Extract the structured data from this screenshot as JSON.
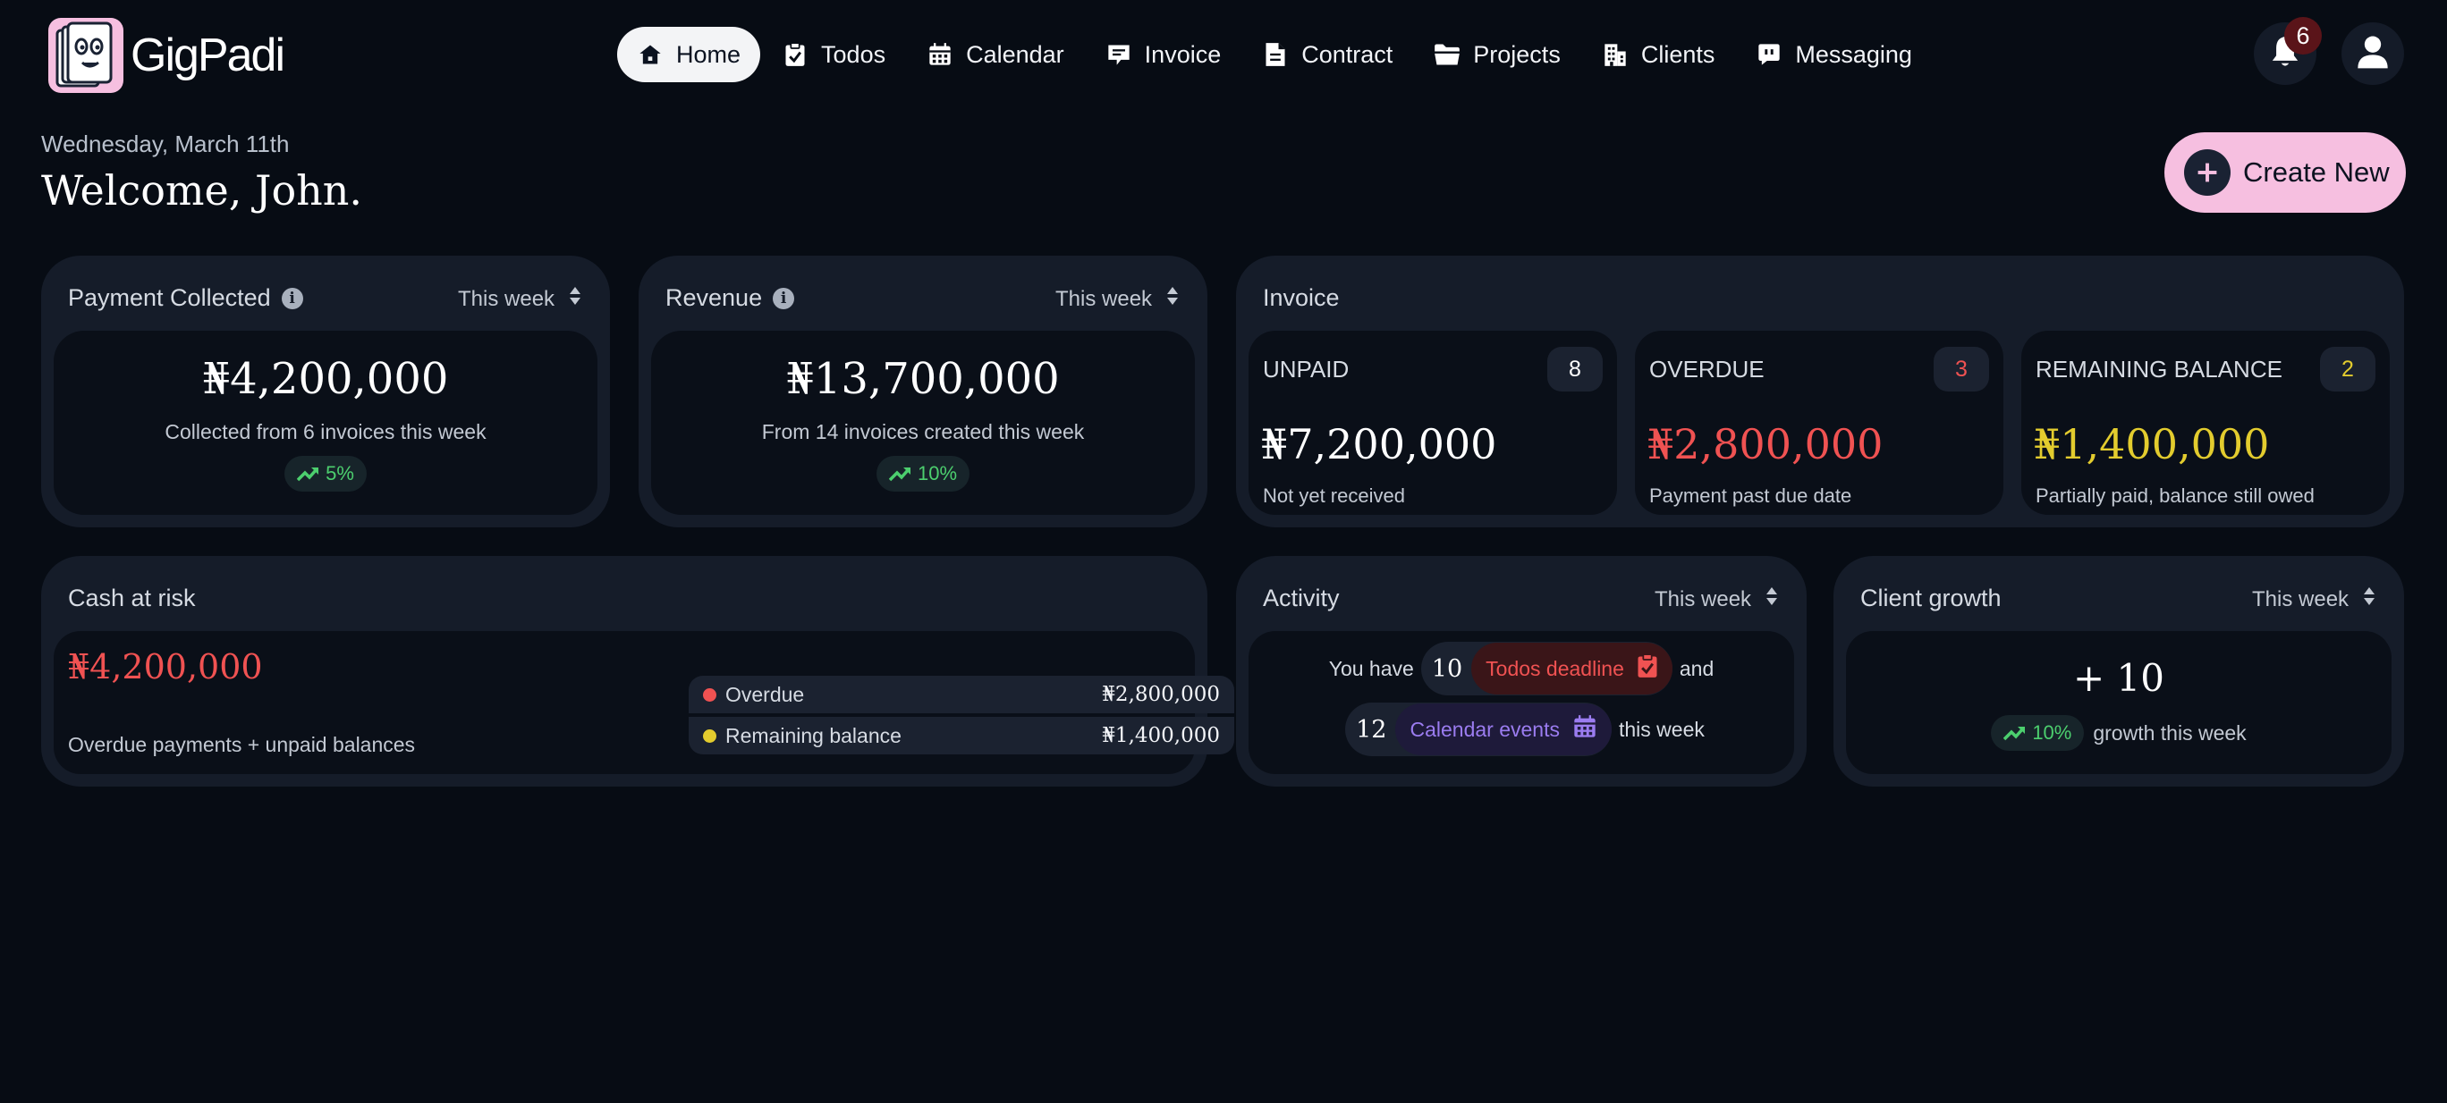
{
  "app": {
    "name": "GigPadi"
  },
  "nav": {
    "items": [
      {
        "label": "Home",
        "icon": "home-icon",
        "active": true
      },
      {
        "label": "Todos",
        "icon": "clipboard-check-icon"
      },
      {
        "label": "Calendar",
        "icon": "calendar-icon"
      },
      {
        "label": "Invoice",
        "icon": "receipt-icon"
      },
      {
        "label": "Contract",
        "icon": "document-icon"
      },
      {
        "label": "Projects",
        "icon": "folder-icon"
      },
      {
        "label": "Clients",
        "icon": "building-icon"
      },
      {
        "label": "Messaging",
        "icon": "message-icon"
      }
    ]
  },
  "notifications": {
    "count": "6"
  },
  "header": {
    "date": "Wednesday, March 11th",
    "welcome": "Welcome, John.",
    "create_label": "Create New"
  },
  "payment_collected": {
    "title": "Payment Collected",
    "period": "This week",
    "amount": "₦4,200,000",
    "caption": "Collected from 6 invoices this week",
    "change": "5%"
  },
  "revenue": {
    "title": "Revenue",
    "period": "This week",
    "amount": "₦13,700,000",
    "caption": "From 14 invoices created this week",
    "change": "10%"
  },
  "invoice": {
    "title": "Invoice",
    "boxes": [
      {
        "label": "UNPAID",
        "count": "8",
        "amount": "₦7,200,000",
        "desc": "Not yet received",
        "color": "#ffffff"
      },
      {
        "label": "OVERDUE",
        "count": "3",
        "amount": "₦2,800,000",
        "desc": "Payment past due date",
        "color": "#f05252"
      },
      {
        "label": "REMAINING BALANCE",
        "count": "2",
        "amount": "₦1,400,000",
        "desc": "Partially paid, balance still owed",
        "color": "#e3cc2e"
      }
    ]
  },
  "cash_at_risk": {
    "title": "Cash at risk",
    "amount": "₦4,200,000",
    "caption": "Overdue payments + unpaid balances",
    "rows": [
      {
        "label": "Overdue",
        "value": "₦2,800,000",
        "color": "#f05252"
      },
      {
        "label": "Remaining balance",
        "value": "₦1,400,000",
        "color": "#e3cc2e"
      }
    ]
  },
  "activity": {
    "title": "Activity",
    "period": "This week",
    "prefix": "You have",
    "todos_count": "10",
    "todos_label": "Todos deadline",
    "joiner": "and",
    "events_count": "12",
    "events_label": "Calendar events",
    "suffix": "this week"
  },
  "client_growth": {
    "title": "Client growth",
    "period": "This week",
    "value": "+ 10",
    "change": "10%",
    "caption": "growth this week"
  },
  "colors": {
    "background": "#070c14",
    "card": "#151c29",
    "inner": "#0a0f18",
    "accent_pink": "#f6bfe0",
    "green": "#4ccf6e",
    "red": "#f05252",
    "yellow": "#e3cc2e",
    "purple": "#9b7cf0"
  }
}
